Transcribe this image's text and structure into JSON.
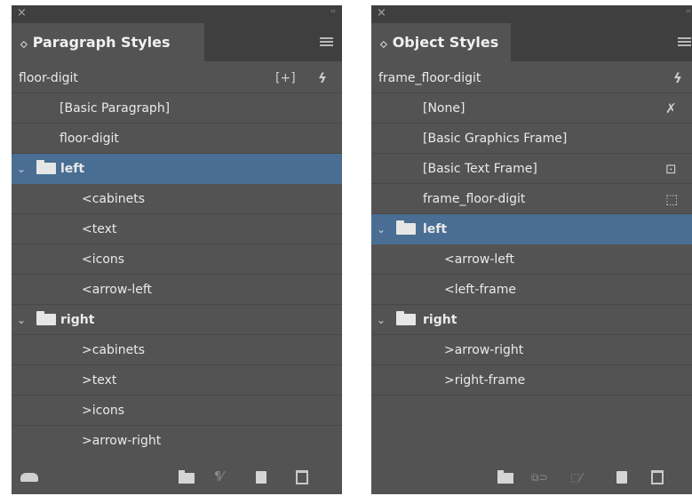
{
  "paragraph_panel": {
    "title": "Paragraph Styles",
    "current_style": "floor-digit",
    "rows": [
      {
        "label": "[Basic Paragraph]",
        "kind": "style"
      },
      {
        "label": "floor-digit",
        "kind": "style"
      },
      {
        "label": "left",
        "kind": "group",
        "selected": true
      },
      {
        "label": "<cabinets",
        "kind": "child"
      },
      {
        "label": "<text",
        "kind": "child"
      },
      {
        "label": "<icons",
        "kind": "child"
      },
      {
        "label": "<arrow-left",
        "kind": "child"
      },
      {
        "label": "right",
        "kind": "group"
      },
      {
        "label": ">cabinets",
        "kind": "child"
      },
      {
        "label": ">text",
        "kind": "child"
      },
      {
        "label": ">icons",
        "kind": "child"
      },
      {
        "label": ">arrow-right",
        "kind": "child"
      }
    ]
  },
  "object_panel": {
    "title": "Object Styles",
    "current_style": "frame_floor-digit",
    "rows": [
      {
        "label": "[None]",
        "kind": "style",
        "icon": "clear-overrides-icon"
      },
      {
        "label": "[Basic Graphics Frame]",
        "kind": "style"
      },
      {
        "label": "[Basic Text Frame]",
        "kind": "style",
        "icon": "text-frame-icon"
      },
      {
        "label": "frame_floor-digit",
        "kind": "style",
        "icon": "graphic-frame-icon"
      },
      {
        "label": "left",
        "kind": "group",
        "selected": true
      },
      {
        "label": "<arrow-left",
        "kind": "child"
      },
      {
        "label": "<left-frame",
        "kind": "child"
      },
      {
        "label": "right",
        "kind": "group"
      },
      {
        "label": ">arrow-right",
        "kind": "child"
      },
      {
        "label": ">right-frame",
        "kind": "child"
      }
    ]
  },
  "glyphs": {
    "close": "×",
    "collapse": "‹‹",
    "tab_chevron": "⬦",
    "disclose_open": "⌄",
    "lightning": "ϟ",
    "add_style": "[+]",
    "clear": "✗",
    "text_frame": "⊡",
    "graphic_frame": "⬚"
  },
  "colors": {
    "panel_bg": "#535353",
    "header_bg": "#3f3f3f",
    "selection": "#4a6e93"
  }
}
